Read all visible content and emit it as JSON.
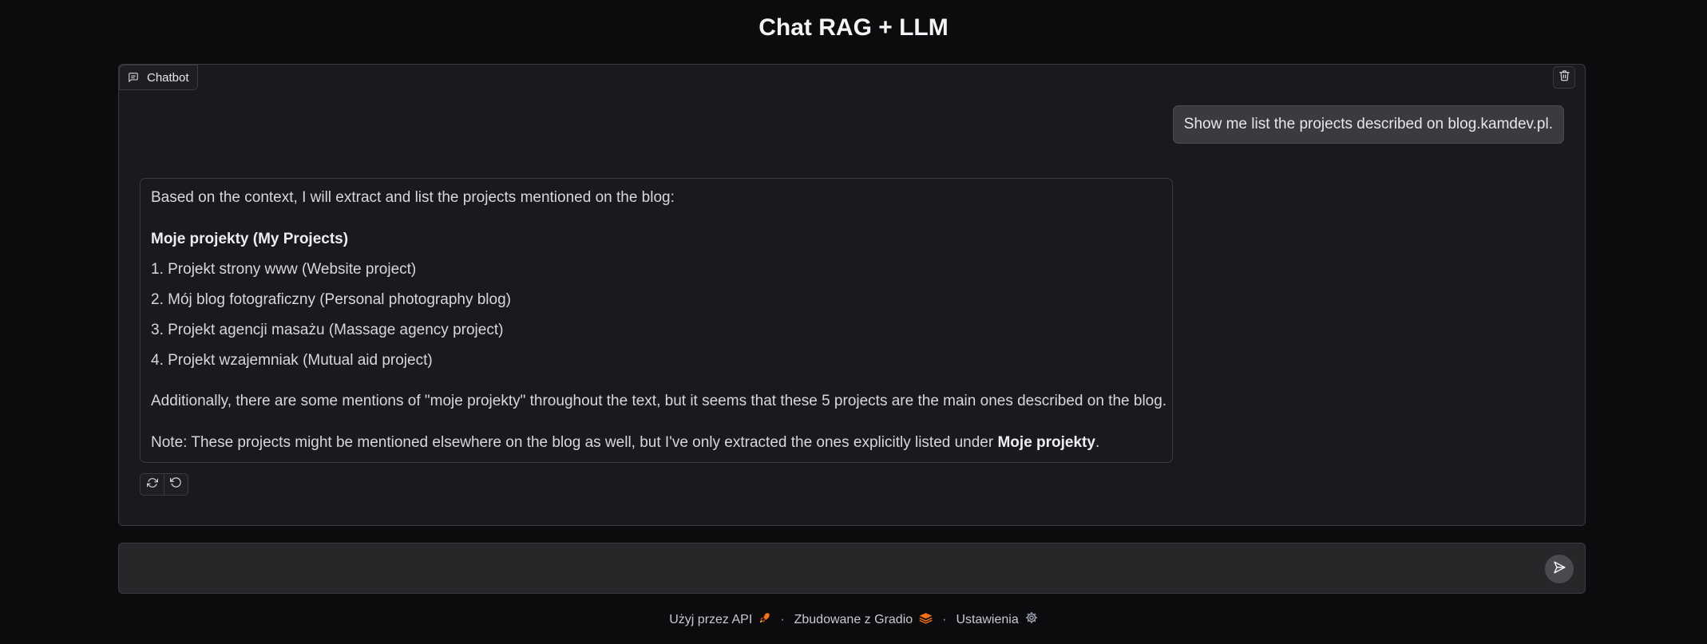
{
  "page": {
    "title": "Chat RAG + LLM"
  },
  "chatbot": {
    "label": "Chatbot",
    "label_icon": "chat-icon",
    "clear_icon": "trash-icon",
    "user_message": "Show me list the projects described on blog.kamdev.pl.",
    "bot_message": {
      "intro": "Based on the context, I will extract and list the projects mentioned on the blog:",
      "heading": "Moje projekty (My Projects)",
      "items": [
        "1. Projekt strony www (Website project)",
        "2. Mój blog fotograficzny (Personal photography blog)",
        "3. Projekt agencji masażu (Massage agency project)",
        "4. Projekt wzajemniak (Mutual aid project)"
      ],
      "additional": "Additionally, there are some mentions of \"moje projekty\" throughout the text, but it seems that these 5 projects are the main ones described on the blog.",
      "note_prefix": "Note: These projects might be mentioned elsewhere on the blog as well, but I've only extracted the ones explicitly listed under ",
      "note_bold": "Moje projekty",
      "note_suffix": "."
    },
    "actions": [
      "retry-icon",
      "undo-icon"
    ]
  },
  "input": {
    "placeholder": "",
    "value": "",
    "send_icon": "send-icon"
  },
  "footer": {
    "api_label": "Użyj przez API",
    "built_label": "Zbudowane z Gradio",
    "settings_label": "Ustawienia",
    "separator": "·"
  },
  "colors": {
    "background": "#0c0c0f",
    "panel": "#1a1a1e",
    "border": "#3a3a40",
    "user_bubble": "#3a3a3f",
    "accent_orange": "#f97316"
  }
}
